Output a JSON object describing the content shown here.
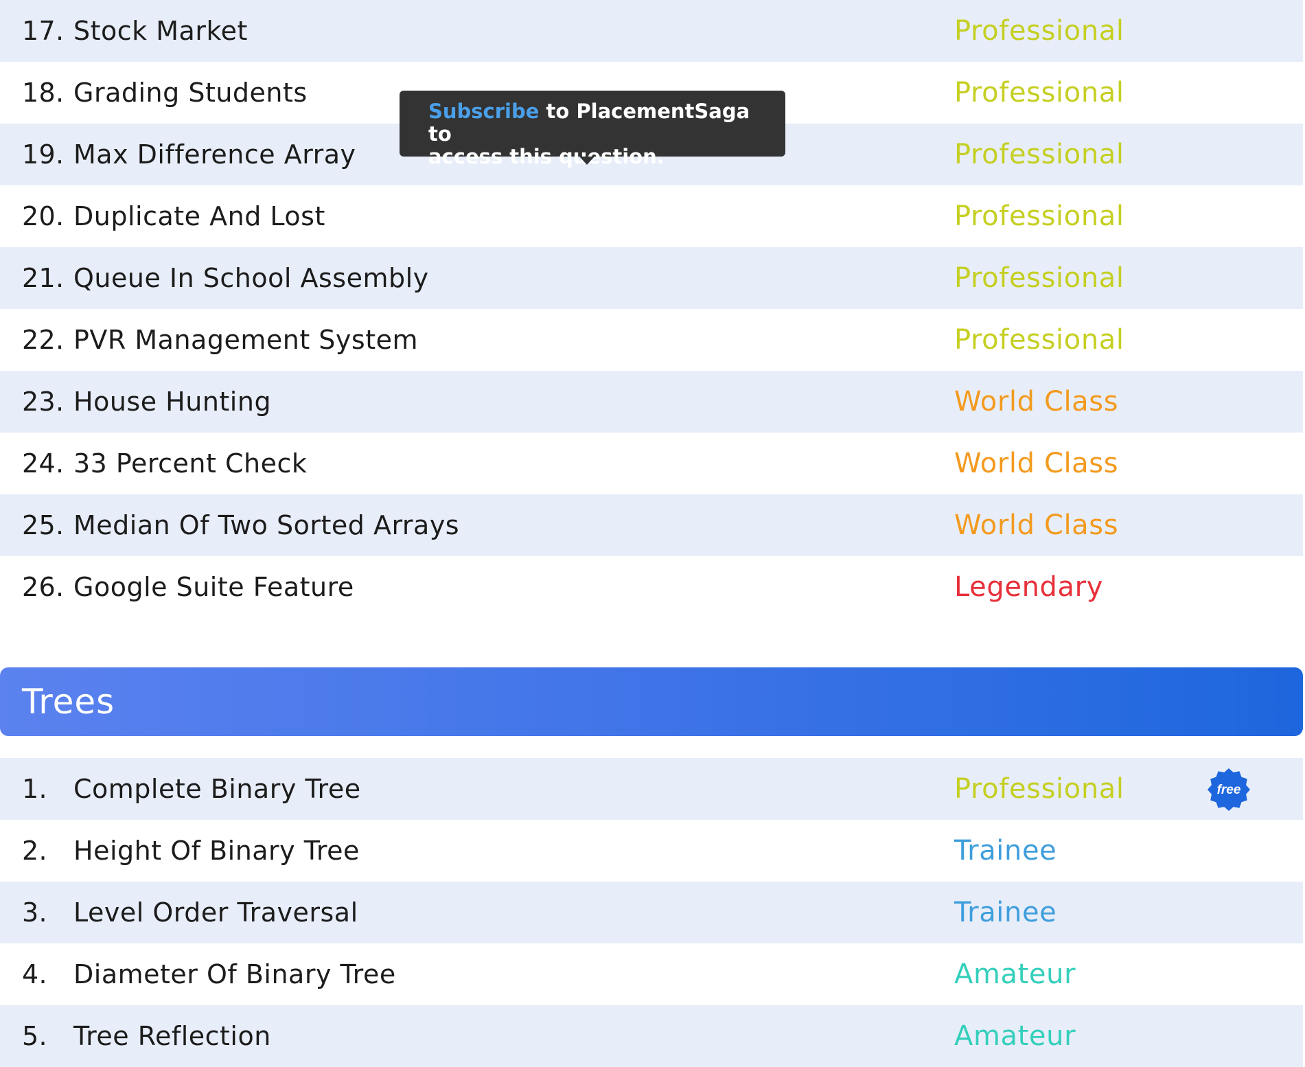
{
  "arrays_problems": [
    {
      "num": "17.",
      "title": "Stock Market",
      "level": "Professional",
      "level_class": "lvl-professional"
    },
    {
      "num": "18.",
      "title": "Grading Students",
      "level": "Professional",
      "level_class": "lvl-professional"
    },
    {
      "num": "19.",
      "title": "Max Difference Array",
      "level": "Professional",
      "level_class": "lvl-professional"
    },
    {
      "num": "20.",
      "title": "Duplicate And Lost",
      "level": "Professional",
      "level_class": "lvl-professional"
    },
    {
      "num": "21.",
      "title": "Queue In School Assembly",
      "level": "Professional",
      "level_class": "lvl-professional"
    },
    {
      "num": "22.",
      "title": "PVR Management System",
      "level": "Professional",
      "level_class": "lvl-professional"
    },
    {
      "num": "23.",
      "title": "House Hunting",
      "level": "World Class",
      "level_class": "lvl-worldclass"
    },
    {
      "num": "24.",
      "title": "33 Percent Check",
      "level": "World Class",
      "level_class": "lvl-worldclass"
    },
    {
      "num": "25.",
      "title": "Median Of Two Sorted Arrays",
      "level": "World Class",
      "level_class": "lvl-worldclass"
    },
    {
      "num": "26.",
      "title": "Google Suite Feature",
      "level": "Legendary",
      "level_class": "lvl-legendary"
    }
  ],
  "trees_section": {
    "title": "Trees",
    "problems": [
      {
        "num": "1.",
        "title": "Complete Binary Tree",
        "level": "Professional",
        "level_class": "lvl-professional",
        "free": true
      },
      {
        "num": "2.",
        "title": "Height Of Binary Tree",
        "level": "Trainee",
        "level_class": "lvl-trainee"
      },
      {
        "num": "3.",
        "title": "Level Order Traversal",
        "level": "Trainee",
        "level_class": "lvl-trainee"
      },
      {
        "num": "4.",
        "title": "Diameter Of Binary Tree",
        "level": "Amateur",
        "level_class": "lvl-amateur"
      },
      {
        "num": "5.",
        "title": "Tree Reflection",
        "level": "Amateur",
        "level_class": "lvl-amateur"
      }
    ]
  },
  "free_badge": {
    "label": "free",
    "color": "#1e66dd",
    "icon": "free-badge-icon"
  },
  "tooltip": {
    "link_text": "Subscribe",
    "text_line1": " to PlacementSaga to",
    "text_line2": "access this question."
  },
  "colors": {
    "professional": "#c5cf22",
    "world_class": "#f39a1f",
    "legendary": "#e7303a",
    "trainee": "#3f9edc",
    "amateur": "#34cfbb",
    "row_shade": "#e8eef9",
    "header_gradient_start": "#5b82ef",
    "header_gradient_end": "#1e66dd"
  }
}
